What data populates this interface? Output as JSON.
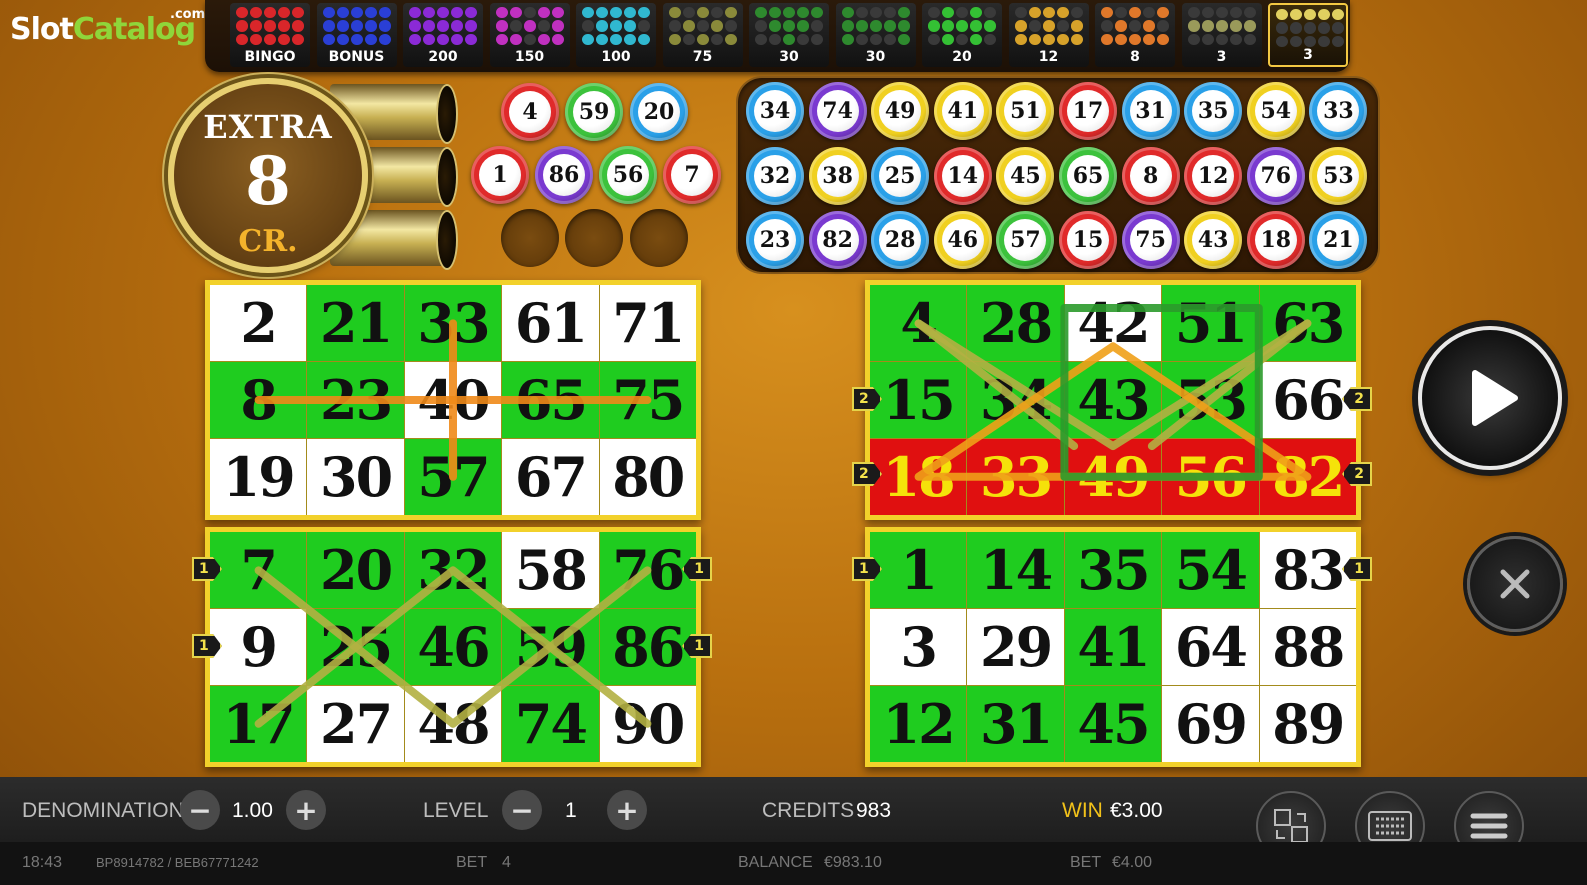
{
  "logo": {
    "slot": "Slot",
    "catalog": "Catalog",
    "com": ".com"
  },
  "patterns": [
    {
      "label": "BINGO",
      "color": "#d9262a"
    },
    {
      "label": "BONUS",
      "color": "#2a3fd6"
    },
    {
      "label": "200",
      "color": "#8b2ad6"
    },
    {
      "label": "150",
      "color": "#c030c0"
    },
    {
      "label": "100",
      "color": "#30b8d0"
    },
    {
      "label": "75",
      "color": "#8a8a3a"
    },
    {
      "label": "30",
      "color": "#2e8a2e"
    },
    {
      "label": "30",
      "color": "#2e8a2e"
    },
    {
      "label": "20",
      "color": "#34c034"
    },
    {
      "label": "12",
      "color": "#d7a22a"
    },
    {
      "label": "8",
      "color": "#e0782a"
    },
    {
      "label": "3",
      "color": "#9a9a5a"
    },
    {
      "label": "3",
      "color": "#e0d060"
    }
  ],
  "extra": {
    "title": "EXTRA",
    "value": "8",
    "unit": "CR."
  },
  "extra_balls": [
    {
      "n": "4",
      "color": "#e02a2a"
    },
    {
      "n": "59",
      "color": "#3cc23c"
    },
    {
      "n": "20",
      "color": "#2aa0e8"
    },
    {
      "n": "1",
      "color": "#e02a2a"
    },
    {
      "n": "86",
      "color": "#7a3ad0"
    },
    {
      "n": "56",
      "color": "#3cc23c"
    },
    {
      "n": "7",
      "color": "#e02a2a"
    }
  ],
  "drawn_balls": [
    {
      "n": "34",
      "color": "#2aa0e8"
    },
    {
      "n": "74",
      "color": "#7a3ad0"
    },
    {
      "n": "49",
      "color": "#f0d020"
    },
    {
      "n": "41",
      "color": "#f0d020"
    },
    {
      "n": "51",
      "color": "#f0d020"
    },
    {
      "n": "17",
      "color": "#e02a2a"
    },
    {
      "n": "31",
      "color": "#2aa0e8"
    },
    {
      "n": "35",
      "color": "#2aa0e8"
    },
    {
      "n": "54",
      "color": "#f0d020"
    },
    {
      "n": "33",
      "color": "#2aa0e8"
    },
    {
      "n": "32",
      "color": "#2aa0e8"
    },
    {
      "n": "38",
      "color": "#f0d020"
    },
    {
      "n": "25",
      "color": "#2aa0e8"
    },
    {
      "n": "14",
      "color": "#e02a2a"
    },
    {
      "n": "45",
      "color": "#f0d020"
    },
    {
      "n": "65",
      "color": "#3cc23c"
    },
    {
      "n": "8",
      "color": "#e02a2a"
    },
    {
      "n": "12",
      "color": "#e02a2a"
    },
    {
      "n": "76",
      "color": "#7a3ad0"
    },
    {
      "n": "53",
      "color": "#f0d020"
    },
    {
      "n": "23",
      "color": "#2aa0e8"
    },
    {
      "n": "82",
      "color": "#7a3ad0"
    },
    {
      "n": "28",
      "color": "#2aa0e8"
    },
    {
      "n": "46",
      "color": "#f0d020"
    },
    {
      "n": "57",
      "color": "#3cc23c"
    },
    {
      "n": "15",
      "color": "#e02a2a"
    },
    {
      "n": "75",
      "color": "#7a3ad0"
    },
    {
      "n": "43",
      "color": "#f0d020"
    },
    {
      "n": "18",
      "color": "#e02a2a"
    },
    {
      "n": "21",
      "color": "#2aa0e8"
    }
  ],
  "cards": [
    {
      "numbers": [
        "2",
        "21",
        "33",
        "61",
        "71",
        "8",
        "23",
        "40",
        "65",
        "75",
        "19",
        "30",
        "57",
        "67",
        "80"
      ],
      "states": [
        "w",
        "h",
        "h",
        "w",
        "w",
        "h",
        "h",
        "w",
        "h",
        "h",
        "w",
        "w",
        "h",
        "w",
        "w"
      ]
    },
    {
      "numbers": [
        "4",
        "28",
        "42",
        "51",
        "63",
        "15",
        "34",
        "43",
        "53",
        "66",
        "18",
        "33",
        "49",
        "56",
        "82"
      ],
      "states": [
        "h",
        "h",
        "w",
        "h",
        "h",
        "h",
        "h",
        "h",
        "h",
        "w",
        "r",
        "r",
        "r",
        "r",
        "r"
      ]
    },
    {
      "numbers": [
        "7",
        "20",
        "32",
        "58",
        "76",
        "9",
        "25",
        "46",
        "59",
        "86",
        "17",
        "27",
        "48",
        "74",
        "90"
      ],
      "states": [
        "h",
        "h",
        "h",
        "w",
        "h",
        "w",
        "h",
        "h",
        "h",
        "h",
        "h",
        "w",
        "w",
        "h",
        "w"
      ]
    },
    {
      "numbers": [
        "1",
        "14",
        "35",
        "54",
        "83",
        "3",
        "29",
        "41",
        "64",
        "88",
        "12",
        "31",
        "45",
        "69",
        "89"
      ],
      "states": [
        "h",
        "h",
        "h",
        "h",
        "w",
        "w",
        "w",
        "h",
        "w",
        "w",
        "h",
        "h",
        "h",
        "w",
        "w"
      ]
    }
  ],
  "line_tags": {
    "card2": [
      "2",
      "2",
      "2",
      "2"
    ],
    "card3": [
      "1",
      "1",
      "1",
      "1"
    ],
    "card4": [
      "1",
      "1"
    ]
  },
  "bottom": {
    "denomination_label": "DENOMINATION",
    "denomination_value": "1.00",
    "level_label": "LEVEL",
    "level_value": "1",
    "credits_label": "CREDITS",
    "credits_value": "983",
    "win_label": "WIN",
    "win_value": "€3.00",
    "minus": "−",
    "plus": "+"
  },
  "status": {
    "time": "18:43",
    "ids": "BP8914782 / BEB67771242",
    "bet_label": "BET",
    "bet_value": "4",
    "balance_label": "BALANCE",
    "balance_value": "€983.10",
    "bet2_label": "BET",
    "bet2_value": "€4.00"
  },
  "colors": {
    "hit": "#1fcc1f",
    "red_row": "#e01010",
    "card_frame": "#f2d12b",
    "win_label": "#f2c21a"
  }
}
